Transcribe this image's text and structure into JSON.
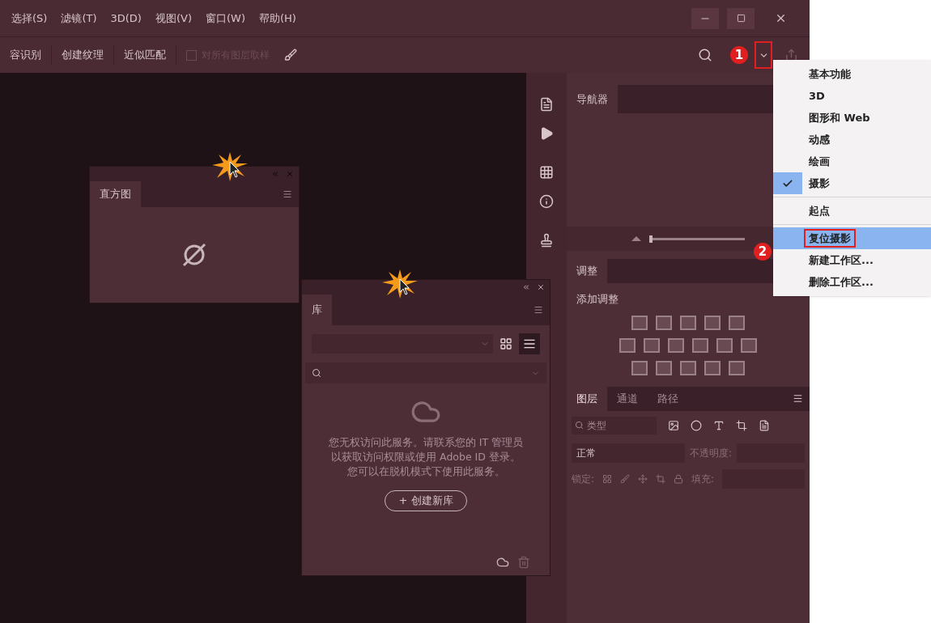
{
  "menu_bar": {
    "items": [
      "选择(S)",
      "滤镜(T)",
      "3D(D)",
      "视图(V)",
      "窗口(W)",
      "帮助(H)"
    ]
  },
  "options_bar": {
    "buttons": [
      "容识别",
      "创建纹理",
      "近似匹配"
    ],
    "sample_all_layers": {
      "label": "对所有图层取样",
      "checked": false,
      "disabled": true
    }
  },
  "callouts": [
    "1",
    "2"
  ],
  "workspace_menu": {
    "groups": [
      [
        {
          "label": "基本功能",
          "checked": false,
          "selected": false
        },
        {
          "label": "3D",
          "checked": false,
          "selected": false
        },
        {
          "label": "图形和 Web",
          "checked": false,
          "selected": false
        },
        {
          "label": "动感",
          "checked": false,
          "selected": false
        },
        {
          "label": "绘画",
          "checked": false,
          "selected": false
        },
        {
          "label": "摄影",
          "checked": true,
          "selected": false
        }
      ],
      [
        {
          "label": "起点",
          "checked": false,
          "selected": false
        }
      ],
      [
        {
          "label": "复位摄影",
          "checked": false,
          "selected": true
        },
        {
          "label": "新建工作区...",
          "checked": false,
          "selected": false
        },
        {
          "label": "删除工作区...",
          "checked": false,
          "selected": false
        }
      ]
    ]
  },
  "histogram_panel": {
    "tab": "直方图"
  },
  "library_panel": {
    "tab": "库",
    "message": "您无权访问此服务。请联系您的 IT 管理员以获取访问权限或使用 Adobe ID 登录。您可以在脱机模式下使用此服务。",
    "create_button": "+ 创建新库"
  },
  "navigator_panel": {
    "tab": "导航器",
    "zoom": {
      "level": 0
    }
  },
  "adjustments_panel": {
    "tab": "调整",
    "label": "添加调整"
  },
  "layers_panel": {
    "tabs": [
      {
        "label": "图层",
        "selected": true
      },
      {
        "label": "通道",
        "selected": false
      },
      {
        "label": "路径",
        "selected": false
      }
    ],
    "filter_placeholder": "类型",
    "blend_mode": "正常",
    "opacity_label": "不透明度:",
    "lock_label": "锁定:",
    "fill_label": "填充:"
  }
}
